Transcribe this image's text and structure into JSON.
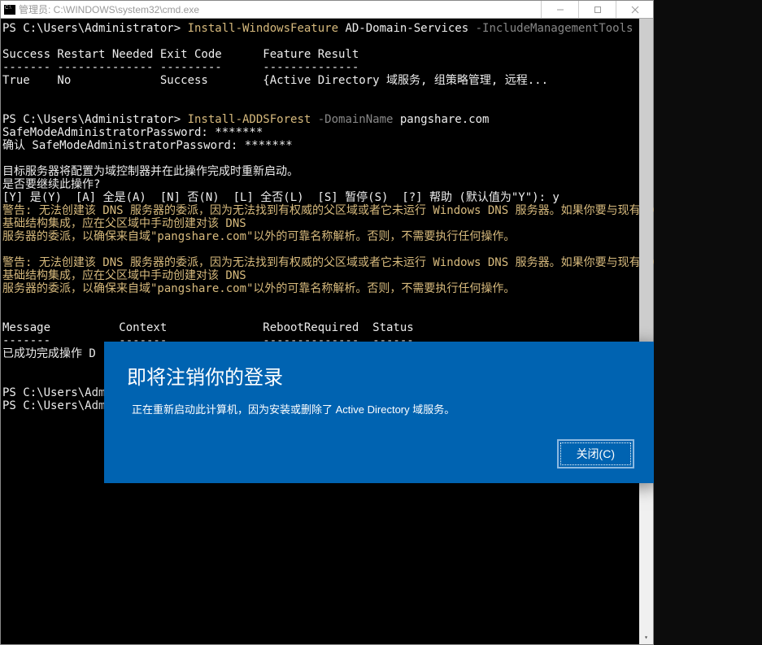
{
  "titlebar": {
    "title": "管理员: C:\\WINDOWS\\system32\\cmd.exe"
  },
  "terminal": {
    "line1_prompt": "PS C:\\Users\\Administrator> ",
    "line1_cmd": "Install-WindowsFeature",
    "line1_arg": " AD-Domain-Services ",
    "line1_flag": "-IncludeManagementTools",
    "blank1": "",
    "line2": "Success Restart Needed Exit Code      Feature Result",
    "line3": "------- -------------- ---------      --------------",
    "line4": "True    No             Success        {Active Directory 域服务, 组策略管理, 远程...",
    "blank2": "",
    "blank3": "",
    "line5_prompt": "PS C:\\Users\\Administrator> ",
    "line5_cmd": "Install-ADDSForest",
    "line5_flag": " -DomainName ",
    "line5_val": "pangshare.com",
    "line6": "SafeModeAdministratorPassword: *******",
    "line7": "确认 SafeModeAdministratorPassword: *******",
    "blank4": "",
    "line8": "目标服务器将配置为域控制器并在此操作完成时重新启动。",
    "line9": "是否要继续此操作?",
    "line10": "[Y] 是(Y)  [A] 全是(A)  [N] 否(N)  [L] 全否(L)  [S] 暂停(S)  [?] 帮助 (默认值为\"Y\"): y",
    "line11": "警告: 无法创建该 DNS 服务器的委派，因为无法找到有权威的父区域或者它未运行 Windows DNS 服务器。如果你要与现有 DNS",
    "line12": "基础结构集成，应在父区域中手动创建对该 DNS",
    "line13": "服务器的委派，以确保来自域\"pangshare.com\"以外的可靠名称解析。否则，不需要执行任何操作。",
    "blank5": "",
    "line14": "警告: 无法创建该 DNS 服务器的委派，因为无法找到有权威的父区域或者它未运行 Windows DNS 服务器。如果你要与现有 DNS",
    "line15": "基础结构集成，应在父区域中手动创建对该 DNS",
    "line16": "服务器的委派，以确保来自域\"pangshare.com\"以外的可靠名称解析。否则，不需要执行任何操作。",
    "blank6": "",
    "blank7": "",
    "line17": "Message          Context              RebootRequired  Status",
    "line18": "-------          -------              --------------  ------",
    "line19": "已成功完成操作 D",
    "blank8": "",
    "blank9": "",
    "line20": "PS C:\\Users\\Admi",
    "line21": "PS C:\\Users\\Admi"
  },
  "dialog": {
    "title": "即将注销你的登录",
    "message": "正在重新启动此计算机，因为安装或删除了 Active Directory 域服务。",
    "close_label": "关闭(C)"
  }
}
